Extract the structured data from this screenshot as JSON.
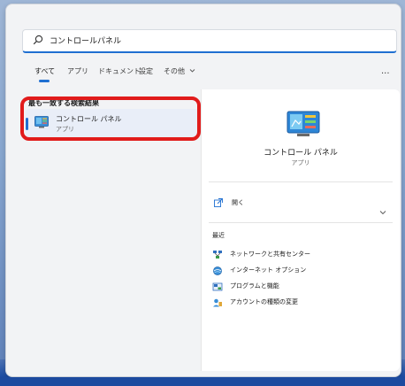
{
  "search": {
    "query": "コントロールパネル"
  },
  "tabs": [
    {
      "label": "すべて",
      "active": true
    },
    {
      "label": "アプリ",
      "active": false
    },
    {
      "label": "ドキュメント",
      "active": false
    },
    {
      "label": "設定",
      "active": false
    },
    {
      "label": "その他",
      "active": false
    }
  ],
  "tabs_more_icon": "chevron-down-icon",
  "more_menu_label": "...",
  "best_match": {
    "heading": "最も一致する検索結果",
    "item": {
      "title": "コントロール パネル",
      "subtitle": "アプリ",
      "icon": "control-panel-icon"
    }
  },
  "details": {
    "app_name": "コントロール パネル",
    "app_kind": "アプリ",
    "open_label": "開く",
    "open_icon": "open-external-icon",
    "expand_icon": "chevron-down-icon",
    "recent_heading": "最近",
    "recent_items": [
      {
        "label": "ネットワークと共有センター",
        "icon": "network-icon"
      },
      {
        "label": "インターネット オプション",
        "icon": "internet-options-icon"
      },
      {
        "label": "プログラムと機能",
        "icon": "programs-icon"
      },
      {
        "label": "アカウントの種類の変更",
        "icon": "user-accounts-icon"
      }
    ]
  },
  "colors": {
    "accent": "#1f6fd1",
    "highlight": "#e11b1b",
    "panel_bg": "#f2f3f5"
  }
}
